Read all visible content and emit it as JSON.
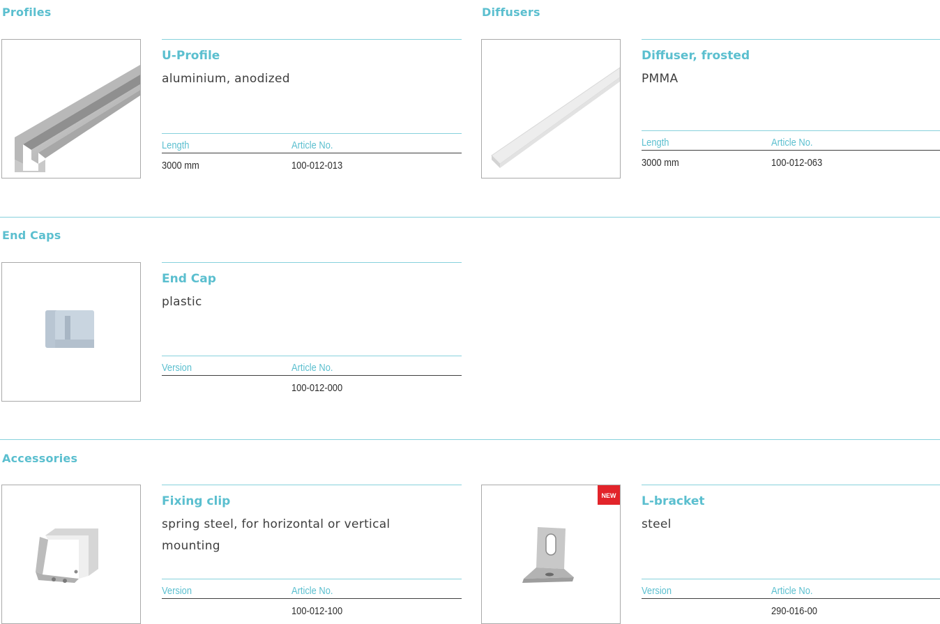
{
  "sections": {
    "profiles": "Profiles",
    "diffusers": "Diffusers",
    "end_caps": "End Caps",
    "accessories": "Accessories"
  },
  "products": {
    "u_profile": {
      "name": "U-Profile",
      "description": "aluminium, anodized",
      "spec_head_1": "Length",
      "spec_head_2": "Article No.",
      "spec_val_1": "3000 mm",
      "spec_val_2": "100-012-013"
    },
    "diffuser": {
      "name": "Diffuser, frosted",
      "description": "PMMA",
      "spec_head_1": "Length",
      "spec_head_2": "Article No.",
      "spec_val_1": "3000 mm",
      "spec_val_2": "100-012-063"
    },
    "end_cap": {
      "name": "End Cap",
      "description": "plastic",
      "spec_head_1": "Version",
      "spec_head_2": "Article No.",
      "spec_val_1": "",
      "spec_val_2": "100-012-000"
    },
    "fixing_clip": {
      "name": "Fixing clip",
      "description": "spring steel, for horizontal or vertical mounting",
      "spec_head_1": "Version",
      "spec_head_2": "Article No.",
      "spec_val_1": "",
      "spec_val_2": "100-012-100"
    },
    "l_bracket": {
      "name": "L-bracket",
      "description": "steel",
      "badge": "NEW",
      "spec_head_1": "Version",
      "spec_head_2": "Article No.",
      "spec_val_1": "",
      "spec_val_2": "290-016-00"
    }
  },
  "colors": {
    "accent": "#5bbfcf",
    "rule": "#86d1dc",
    "text": "#3e3e3e",
    "badge": "#e2242a"
  }
}
